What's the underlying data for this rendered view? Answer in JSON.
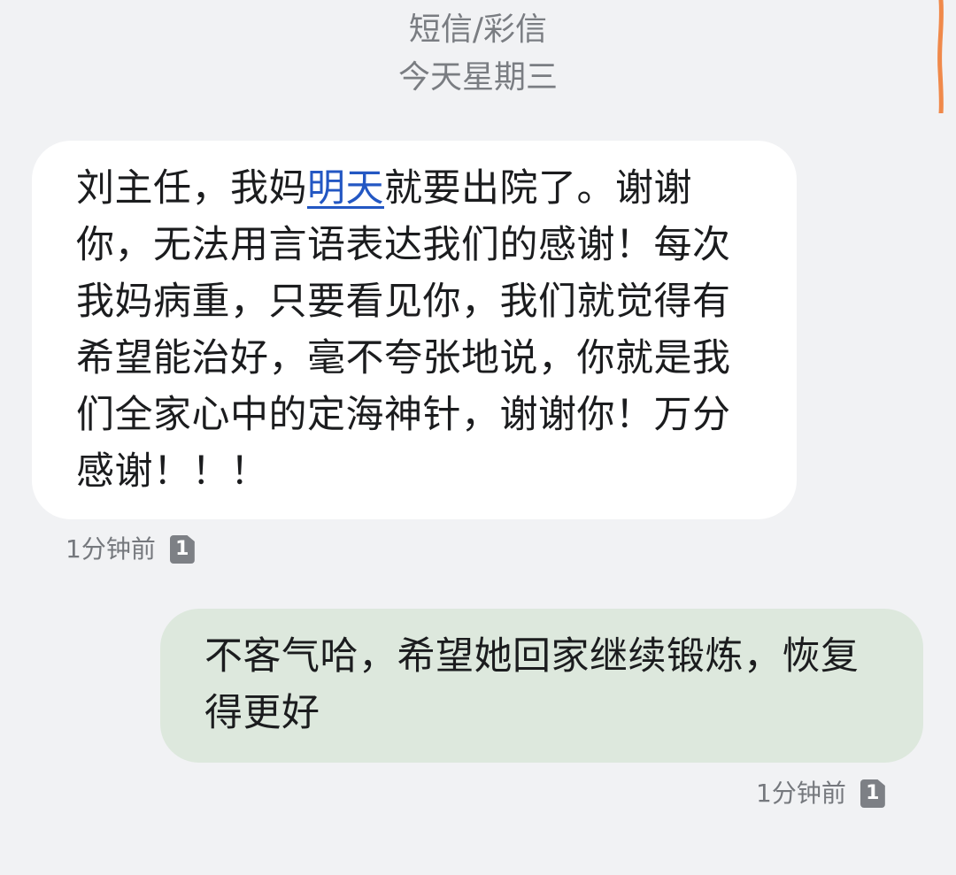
{
  "header": {
    "channel": "短信/彩信",
    "date": "今天星期三"
  },
  "messages": [
    {
      "direction": "incoming",
      "text_before": "刘主任，我妈",
      "link_text": "明天",
      "text_after": "就要出院了。谢谢你，无法用言语表达我们的感谢！每次我妈病重，只要看见你，我们就觉得有希望能治好，毫不夸张地说，你就是我们全家心中的定海神针，谢谢你！万分感谢！！！",
      "time": "1分钟前",
      "sim": "1"
    },
    {
      "direction": "outgoing",
      "text": "不客气哈，希望她回家继续锻炼，恢复得更好",
      "time": "1分钟前",
      "sim": "1"
    }
  ],
  "colors": {
    "background": "#f1f2f4",
    "incoming_bubble": "#ffffff",
    "outgoing_bubble": "#dde8dd",
    "link": "#2357c3",
    "scroll_indicator": "#f0894a"
  }
}
